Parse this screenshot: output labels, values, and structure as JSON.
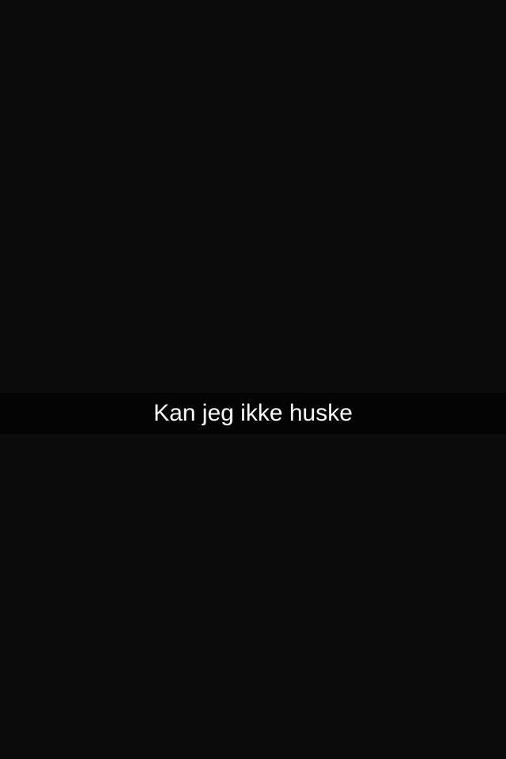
{
  "snap": {
    "background_color": "#0b0b0b",
    "caption": {
      "text": "Kan jeg ikke huske",
      "text_color": "#ffffff",
      "bar_color": "#000000"
    }
  }
}
